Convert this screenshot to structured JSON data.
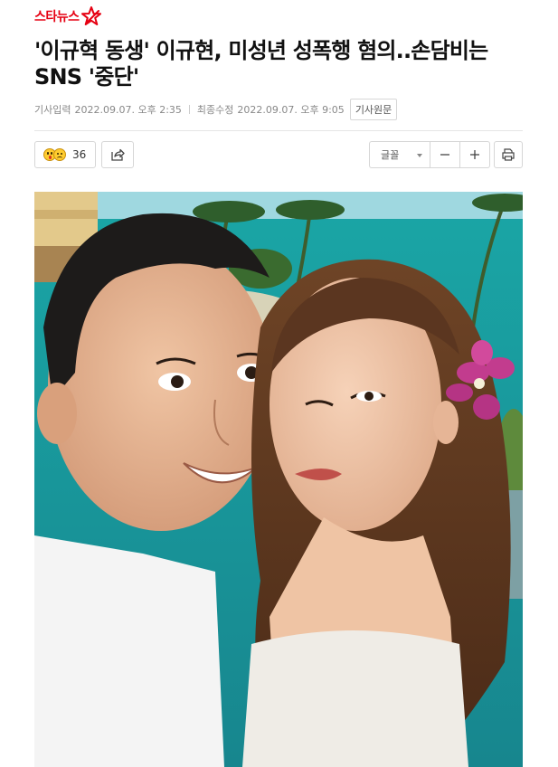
{
  "header": {
    "logo_text": "스타뉴스",
    "logo_icon": "star-icon",
    "brand_color": "#e60012"
  },
  "article": {
    "headline": "'이규혁 동생' 이규현, 미성년 성폭행 혐의..손담비는 SNS '중단'",
    "published_label": "기사입력",
    "published_value": "2022.09.07. 오후 2:35",
    "modified_label": "최종수정",
    "modified_value": "2022.09.07. 오후 9:05",
    "origin_button": "기사원문"
  },
  "toolbar": {
    "reaction_icons": [
      "surprised-emoji-icon",
      "sad-emoji-icon"
    ],
    "reaction_count": "36",
    "share_icon": "share-icon",
    "font_label": "글꼴",
    "font_caret_icon": "caret-down-icon",
    "minus_icon": "minus-icon",
    "plus_icon": "plus-icon",
    "print_icon": "print-icon"
  },
  "photo": {
    "subject": "selfie-photo"
  }
}
